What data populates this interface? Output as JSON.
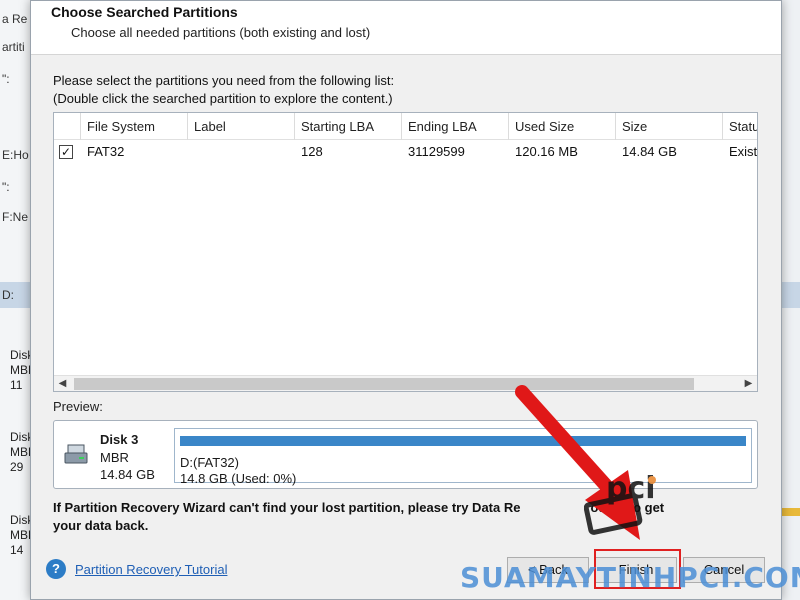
{
  "background_app": {
    "fragments": [
      "a Re",
      "artiti",
      "\":",
      "E:Ho",
      "\":",
      "F:Ne",
      "D:"
    ],
    "disks": [
      {
        "label": "Disk",
        "type": "MBR",
        "size": "11"
      },
      {
        "label": "Disk",
        "type": "MBR",
        "size": "29"
      },
      {
        "label": "Disk",
        "type": "MBR",
        "size": "14"
      }
    ]
  },
  "dialog": {
    "title": "Choose Searched Partitions",
    "subtitle": "Choose all needed partitions (both existing and lost)",
    "instruction_line1": "Please select the partitions you need from the following list:",
    "instruction_line2": "(Double click the searched partition to explore the content.)",
    "columns": [
      "File System",
      "Label",
      "Starting LBA",
      "Ending LBA",
      "Used Size",
      "Size",
      "Statu"
    ],
    "rows": [
      {
        "checked": true,
        "check_mark": "✓",
        "file_system": "FAT32",
        "label": "",
        "starting_lba": "128",
        "ending_lba": "31129599",
        "used_size": "120.16 MB",
        "size": "14.84 GB",
        "status": "Exist"
      }
    ],
    "preview_label": "Preview:",
    "preview": {
      "disk_name": "Disk 3",
      "disk_type": "MBR",
      "disk_size": "14.84 GB",
      "partition_name": "D:(FAT32)",
      "partition_usage": "14.8 GB (Used: 0%)",
      "bar_color": "#3a86c8"
    },
    "bottom_note_line1": "If Partition Recovery Wizard can't find your lost partition, please try Data Re",
    "bottom_note_tail": "odule to get",
    "bottom_note_line2": "your data back.",
    "help_icon": "question-circle-icon",
    "help_glyph": "?",
    "tutorial_link": "Partition Recovery Tutorial",
    "buttons": {
      "back": "< Back",
      "finish": "Finish",
      "cancel": "Cancel"
    }
  },
  "annotation": {
    "arrow_color": "#e01818",
    "highlight_color": "#e02020"
  },
  "watermark": {
    "text": "SUAMAYTINHPCI.COM",
    "logo": "pci",
    "color": "#4c8fd6"
  }
}
